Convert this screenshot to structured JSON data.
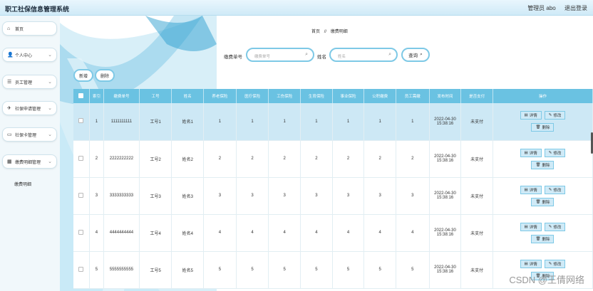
{
  "header": {
    "title": "职工社保信息管理系统",
    "user": "管理员 abo",
    "logout": "退出登录"
  },
  "sidebar": {
    "items": [
      {
        "icon": "home-icon",
        "glyph": "⌂",
        "label": "首页",
        "expandable": false
      },
      {
        "icon": "user-icon",
        "glyph": "👤",
        "label": "个人中心",
        "expandable": true
      },
      {
        "icon": "staff-icon",
        "glyph": "☰",
        "label": "员工管理",
        "expandable": true
      },
      {
        "icon": "send-icon",
        "glyph": "✈",
        "label": "社保申请管理",
        "expandable": true
      },
      {
        "icon": "card-icon",
        "glyph": "▭",
        "label": "社保卡管理",
        "expandable": true
      },
      {
        "icon": "grid-icon",
        "glyph": "▦",
        "label": "缴费明细管理",
        "expandable": true
      }
    ],
    "sub_item": "缴费明细"
  },
  "breadcrumb": {
    "home": "首页",
    "sep": "//",
    "current": "缴费明细"
  },
  "filters": {
    "order_label": "缴费单号",
    "order_placeholder": "缴费单号",
    "name_label": "姓名",
    "name_placeholder": "姓名",
    "search_label": "查询"
  },
  "actions": {
    "add": "新增",
    "delete": "删除"
  },
  "table": {
    "headers": [
      "索引",
      "缴费单号",
      "工号",
      "姓名",
      "养老保险",
      "医疗保险",
      "工伤保险",
      "生育保险",
      "事业保险",
      "公积缴费",
      "员工需缴",
      "发布时间",
      "是否支付",
      "操作"
    ],
    "buttons": {
      "detail": "详情",
      "edit": "修改",
      "delete": "删除"
    },
    "rows": [
      {
        "idx": "1",
        "order": "1111111111",
        "job": "工号1",
        "name": "姓名1",
        "v1": "1",
        "v2": "1",
        "v3": "1",
        "v4": "1",
        "v5": "1",
        "v6": "1",
        "v7": "1",
        "date": "2022-04-30",
        "time": "15:38:16",
        "paid": "未支付"
      },
      {
        "idx": "2",
        "order": "2222222222",
        "job": "工号2",
        "name": "姓名2",
        "v1": "2",
        "v2": "2",
        "v3": "2",
        "v4": "2",
        "v5": "2",
        "v6": "2",
        "v7": "2",
        "date": "2022-04-30",
        "time": "15:38:16",
        "paid": "未支付"
      },
      {
        "idx": "3",
        "order": "3333333333",
        "job": "工号3",
        "name": "姓名3",
        "v1": "3",
        "v2": "3",
        "v3": "3",
        "v4": "3",
        "v5": "3",
        "v6": "3",
        "v7": "3",
        "date": "2022-04-30",
        "time": "15:38:16",
        "paid": "未支付"
      },
      {
        "idx": "4",
        "order": "4444444444",
        "job": "工号4",
        "name": "姓名4",
        "v1": "4",
        "v2": "4",
        "v3": "4",
        "v4": "4",
        "v5": "4",
        "v6": "4",
        "v7": "4",
        "date": "2022-04-30",
        "time": "15:38:16",
        "paid": "未支付"
      },
      {
        "idx": "5",
        "order": "5555555555",
        "job": "工号5",
        "name": "姓名5",
        "v1": "5",
        "v2": "5",
        "v3": "5",
        "v4": "5",
        "v5": "5",
        "v6": "5",
        "v7": "5",
        "date": "2022-04-30",
        "time": "15:38:16",
        "paid": "未支付"
      }
    ]
  },
  "watermark": "CSDN @王倩网络",
  "colors": {
    "accent": "#6ac2e2",
    "selected_row": "#cde8f5",
    "border": "#7ec9e6"
  }
}
